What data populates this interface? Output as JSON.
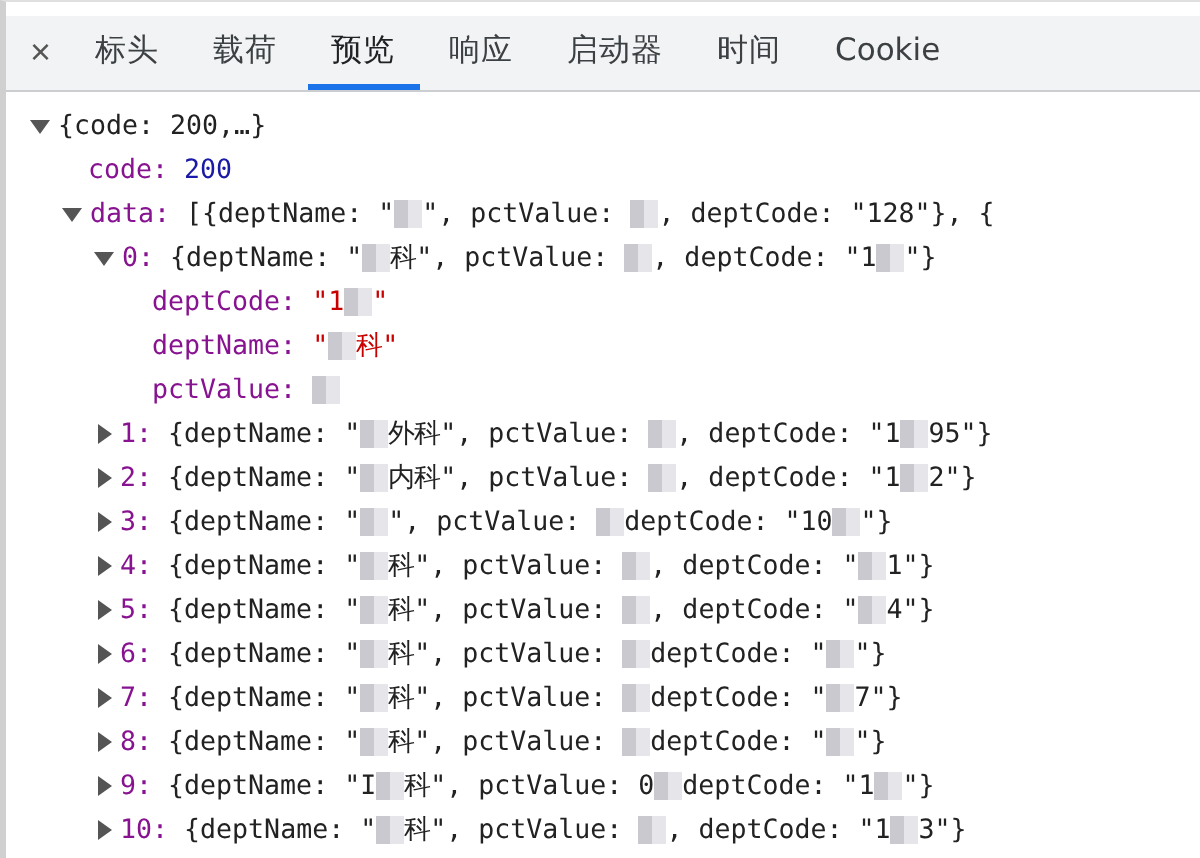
{
  "tabs": [
    {
      "label": "标头",
      "selected": false
    },
    {
      "label": "载荷",
      "selected": false
    },
    {
      "label": "预览",
      "selected": true
    },
    {
      "label": "响应",
      "selected": false
    },
    {
      "label": "启动器",
      "selected": false
    },
    {
      "label": "时间",
      "selected": false
    },
    {
      "label": "Cookie",
      "selected": false
    }
  ],
  "close": "×",
  "tree": [
    {
      "expanded": true,
      "segments": [
        {
          "kind": "text",
          "text": "{code: 200,…}"
        }
      ],
      "children": [
        {
          "segments": [
            {
              "kind": "key",
              "text": "code:"
            },
            {
              "kind": "number",
              "text": "200"
            }
          ]
        },
        {
          "expanded": true,
          "segments": [
            {
              "kind": "key",
              "text": "data:"
            },
            {
              "kind": "text",
              "text": "[{deptName: \""
            },
            {
              "kind": "mosaic"
            },
            {
              "kind": "text",
              "text": "\", pctValue: "
            },
            {
              "kind": "mosaic"
            },
            {
              "kind": "text",
              "text": ", deptCode: \"128\"}, {"
            }
          ],
          "children": [
            {
              "expanded": true,
              "segments": [
                {
                  "kind": "key",
                  "text": "0:"
                },
                {
                  "kind": "text",
                  "text": "{deptName: \""
                },
                {
                  "kind": "mosaic"
                },
                {
                  "kind": "text",
                  "text": "科\", pctValue: "
                },
                {
                  "kind": "mosaic"
                },
                {
                  "kind": "text",
                  "text": ", deptCode: \"1"
                },
                {
                  "kind": "mosaic"
                },
                {
                  "kind": "text",
                  "text": "\"}"
                }
              ],
              "children": [
                {
                  "segments": [
                    {
                      "kind": "key",
                      "text": "deptCode:"
                    },
                    {
                      "kind": "string",
                      "text": "\"1"
                    },
                    {
                      "kind": "mosaic"
                    },
                    {
                      "kind": "string",
                      "text": "\""
                    }
                  ]
                },
                {
                  "segments": [
                    {
                      "kind": "key",
                      "text": "deptName:"
                    },
                    {
                      "kind": "string",
                      "text": "\""
                    },
                    {
                      "kind": "mosaic"
                    },
                    {
                      "kind": "string",
                      "text": "科\""
                    }
                  ]
                },
                {
                  "segments": [
                    {
                      "kind": "key",
                      "text": "pctValue:"
                    },
                    {
                      "kind": "mosaic"
                    }
                  ]
                }
              ]
            },
            {
              "expanded": false,
              "segments": [
                {
                  "kind": "key",
                  "text": "1:"
                },
                {
                  "kind": "text",
                  "text": "{deptName: \""
                },
                {
                  "kind": "mosaic"
                },
                {
                  "kind": "text",
                  "text": "外科\", pctValue: "
                },
                {
                  "kind": "mosaic"
                },
                {
                  "kind": "text",
                  "text": ", deptCode: \"1"
                },
                {
                  "kind": "mosaic"
                },
                {
                  "kind": "text",
                  "text": "95\"}"
                }
              ]
            },
            {
              "expanded": false,
              "segments": [
                {
                  "kind": "key",
                  "text": "2:"
                },
                {
                  "kind": "text",
                  "text": "{deptName: \""
                },
                {
                  "kind": "mosaic"
                },
                {
                  "kind": "text",
                  "text": "内科\", pctValue: "
                },
                {
                  "kind": "mosaic"
                },
                {
                  "kind": "text",
                  "text": ", deptCode: \"1"
                },
                {
                  "kind": "mosaic"
                },
                {
                  "kind": "text",
                  "text": "2\"}"
                }
              ]
            },
            {
              "expanded": false,
              "segments": [
                {
                  "kind": "key",
                  "text": "3:"
                },
                {
                  "kind": "text",
                  "text": "{deptName: \""
                },
                {
                  "kind": "mosaic"
                },
                {
                  "kind": "text",
                  "text": "\", pctValue: "
                },
                {
                  "kind": "mosaic"
                },
                {
                  "kind": "text",
                  "text": "deptCode: \"10"
                },
                {
                  "kind": "mosaic"
                },
                {
                  "kind": "text",
                  "text": "\"}"
                }
              ]
            },
            {
              "expanded": false,
              "segments": [
                {
                  "kind": "key",
                  "text": "4:"
                },
                {
                  "kind": "text",
                  "text": "{deptName: \""
                },
                {
                  "kind": "mosaic"
                },
                {
                  "kind": "text",
                  "text": "科\", pctValue: "
                },
                {
                  "kind": "mosaic"
                },
                {
                  "kind": "text",
                  "text": ", deptCode: \""
                },
                {
                  "kind": "mosaic"
                },
                {
                  "kind": "text",
                  "text": "1\"}"
                }
              ]
            },
            {
              "expanded": false,
              "segments": [
                {
                  "kind": "key",
                  "text": "5:"
                },
                {
                  "kind": "text",
                  "text": "{deptName: \""
                },
                {
                  "kind": "mosaic"
                },
                {
                  "kind": "text",
                  "text": "科\", pctValue: "
                },
                {
                  "kind": "mosaic"
                },
                {
                  "kind": "text",
                  "text": ", deptCode: \""
                },
                {
                  "kind": "mosaic"
                },
                {
                  "kind": "text",
                  "text": "4\"}"
                }
              ]
            },
            {
              "expanded": false,
              "segments": [
                {
                  "kind": "key",
                  "text": "6:"
                },
                {
                  "kind": "text",
                  "text": "{deptName: \""
                },
                {
                  "kind": "mosaic"
                },
                {
                  "kind": "text",
                  "text": "科\", pctValue: "
                },
                {
                  "kind": "mosaic"
                },
                {
                  "kind": "text",
                  "text": "deptCode: \""
                },
                {
                  "kind": "mosaic"
                },
                {
                  "kind": "text",
                  "text": "\"}"
                }
              ]
            },
            {
              "expanded": false,
              "segments": [
                {
                  "kind": "key",
                  "text": "7:"
                },
                {
                  "kind": "text",
                  "text": "{deptName: \""
                },
                {
                  "kind": "mosaic"
                },
                {
                  "kind": "text",
                  "text": "科\", pctValue: "
                },
                {
                  "kind": "mosaic"
                },
                {
                  "kind": "text",
                  "text": "deptCode: \""
                },
                {
                  "kind": "mosaic"
                },
                {
                  "kind": "text",
                  "text": "7\"}"
                }
              ]
            },
            {
              "expanded": false,
              "segments": [
                {
                  "kind": "key",
                  "text": "8:"
                },
                {
                  "kind": "text",
                  "text": "{deptName: \""
                },
                {
                  "kind": "mosaic"
                },
                {
                  "kind": "text",
                  "text": "科\", pctValue: "
                },
                {
                  "kind": "mosaic"
                },
                {
                  "kind": "text",
                  "text": "deptCode: \""
                },
                {
                  "kind": "mosaic"
                },
                {
                  "kind": "text",
                  "text": "\"}"
                }
              ]
            },
            {
              "expanded": false,
              "segments": [
                {
                  "kind": "key",
                  "text": "9:"
                },
                {
                  "kind": "text",
                  "text": "{deptName: \"I"
                },
                {
                  "kind": "mosaic"
                },
                {
                  "kind": "text",
                  "text": "科\", pctValue: 0"
                },
                {
                  "kind": "mosaic"
                },
                {
                  "kind": "text",
                  "text": "deptCode: \"1"
                },
                {
                  "kind": "mosaic"
                },
                {
                  "kind": "text",
                  "text": "\"}"
                }
              ]
            },
            {
              "expanded": false,
              "segments": [
                {
                  "kind": "key",
                  "text": "10:"
                },
                {
                  "kind": "text",
                  "text": "{deptName: \""
                },
                {
                  "kind": "mosaic"
                },
                {
                  "kind": "text",
                  "text": "科\", pctValue: "
                },
                {
                  "kind": "mosaic"
                },
                {
                  "kind": "text",
                  "text": ", deptCode: \"1"
                },
                {
                  "kind": "mosaic"
                },
                {
                  "kind": "text",
                  "text": "3\"}"
                }
              ]
            }
          ]
        }
      ]
    }
  ]
}
